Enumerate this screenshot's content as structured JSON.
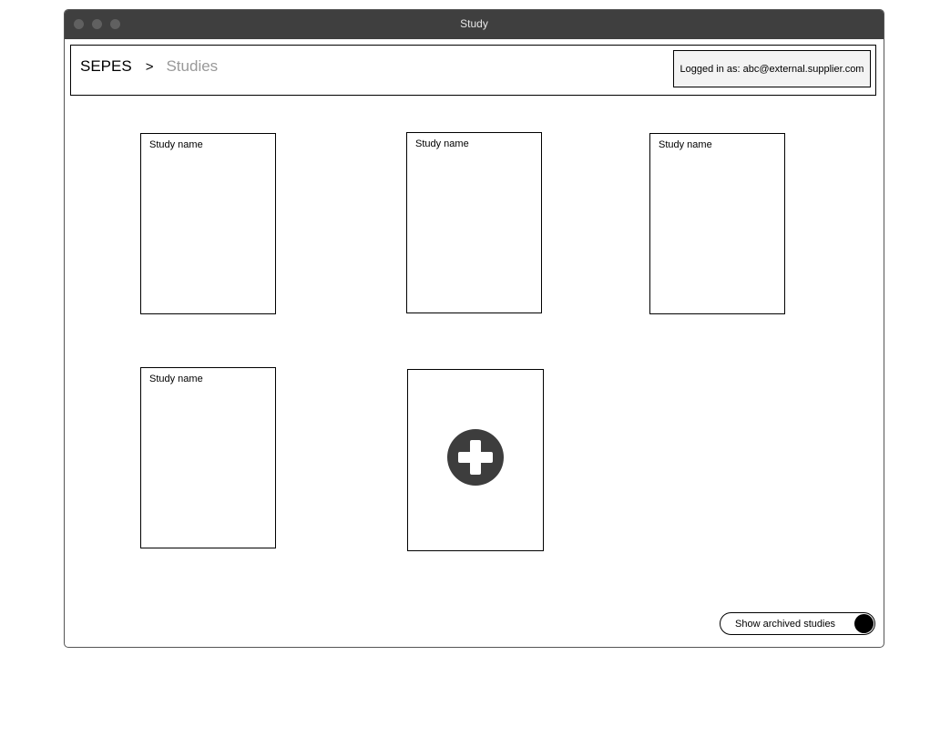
{
  "window": {
    "title": "Study"
  },
  "header": {
    "breadcrumb": {
      "root": "SEPES",
      "separator": ">",
      "current": "Studies"
    },
    "login_text": "Logged in as: abc@external.supplier.com"
  },
  "studies": [
    {
      "name": "Study name"
    },
    {
      "name": "Study name"
    },
    {
      "name": "Study name"
    },
    {
      "name": "Study name"
    }
  ],
  "add_study": {
    "icon": "plus-circle-icon"
  },
  "archived_toggle": {
    "label": "Show archived studies",
    "state": "on"
  },
  "colors": {
    "titlebar": "#3f3f3f",
    "breadcrumb_current": "#999999",
    "login_box_bg": "#f3f3f3",
    "add_icon": "#3d3d3d"
  }
}
